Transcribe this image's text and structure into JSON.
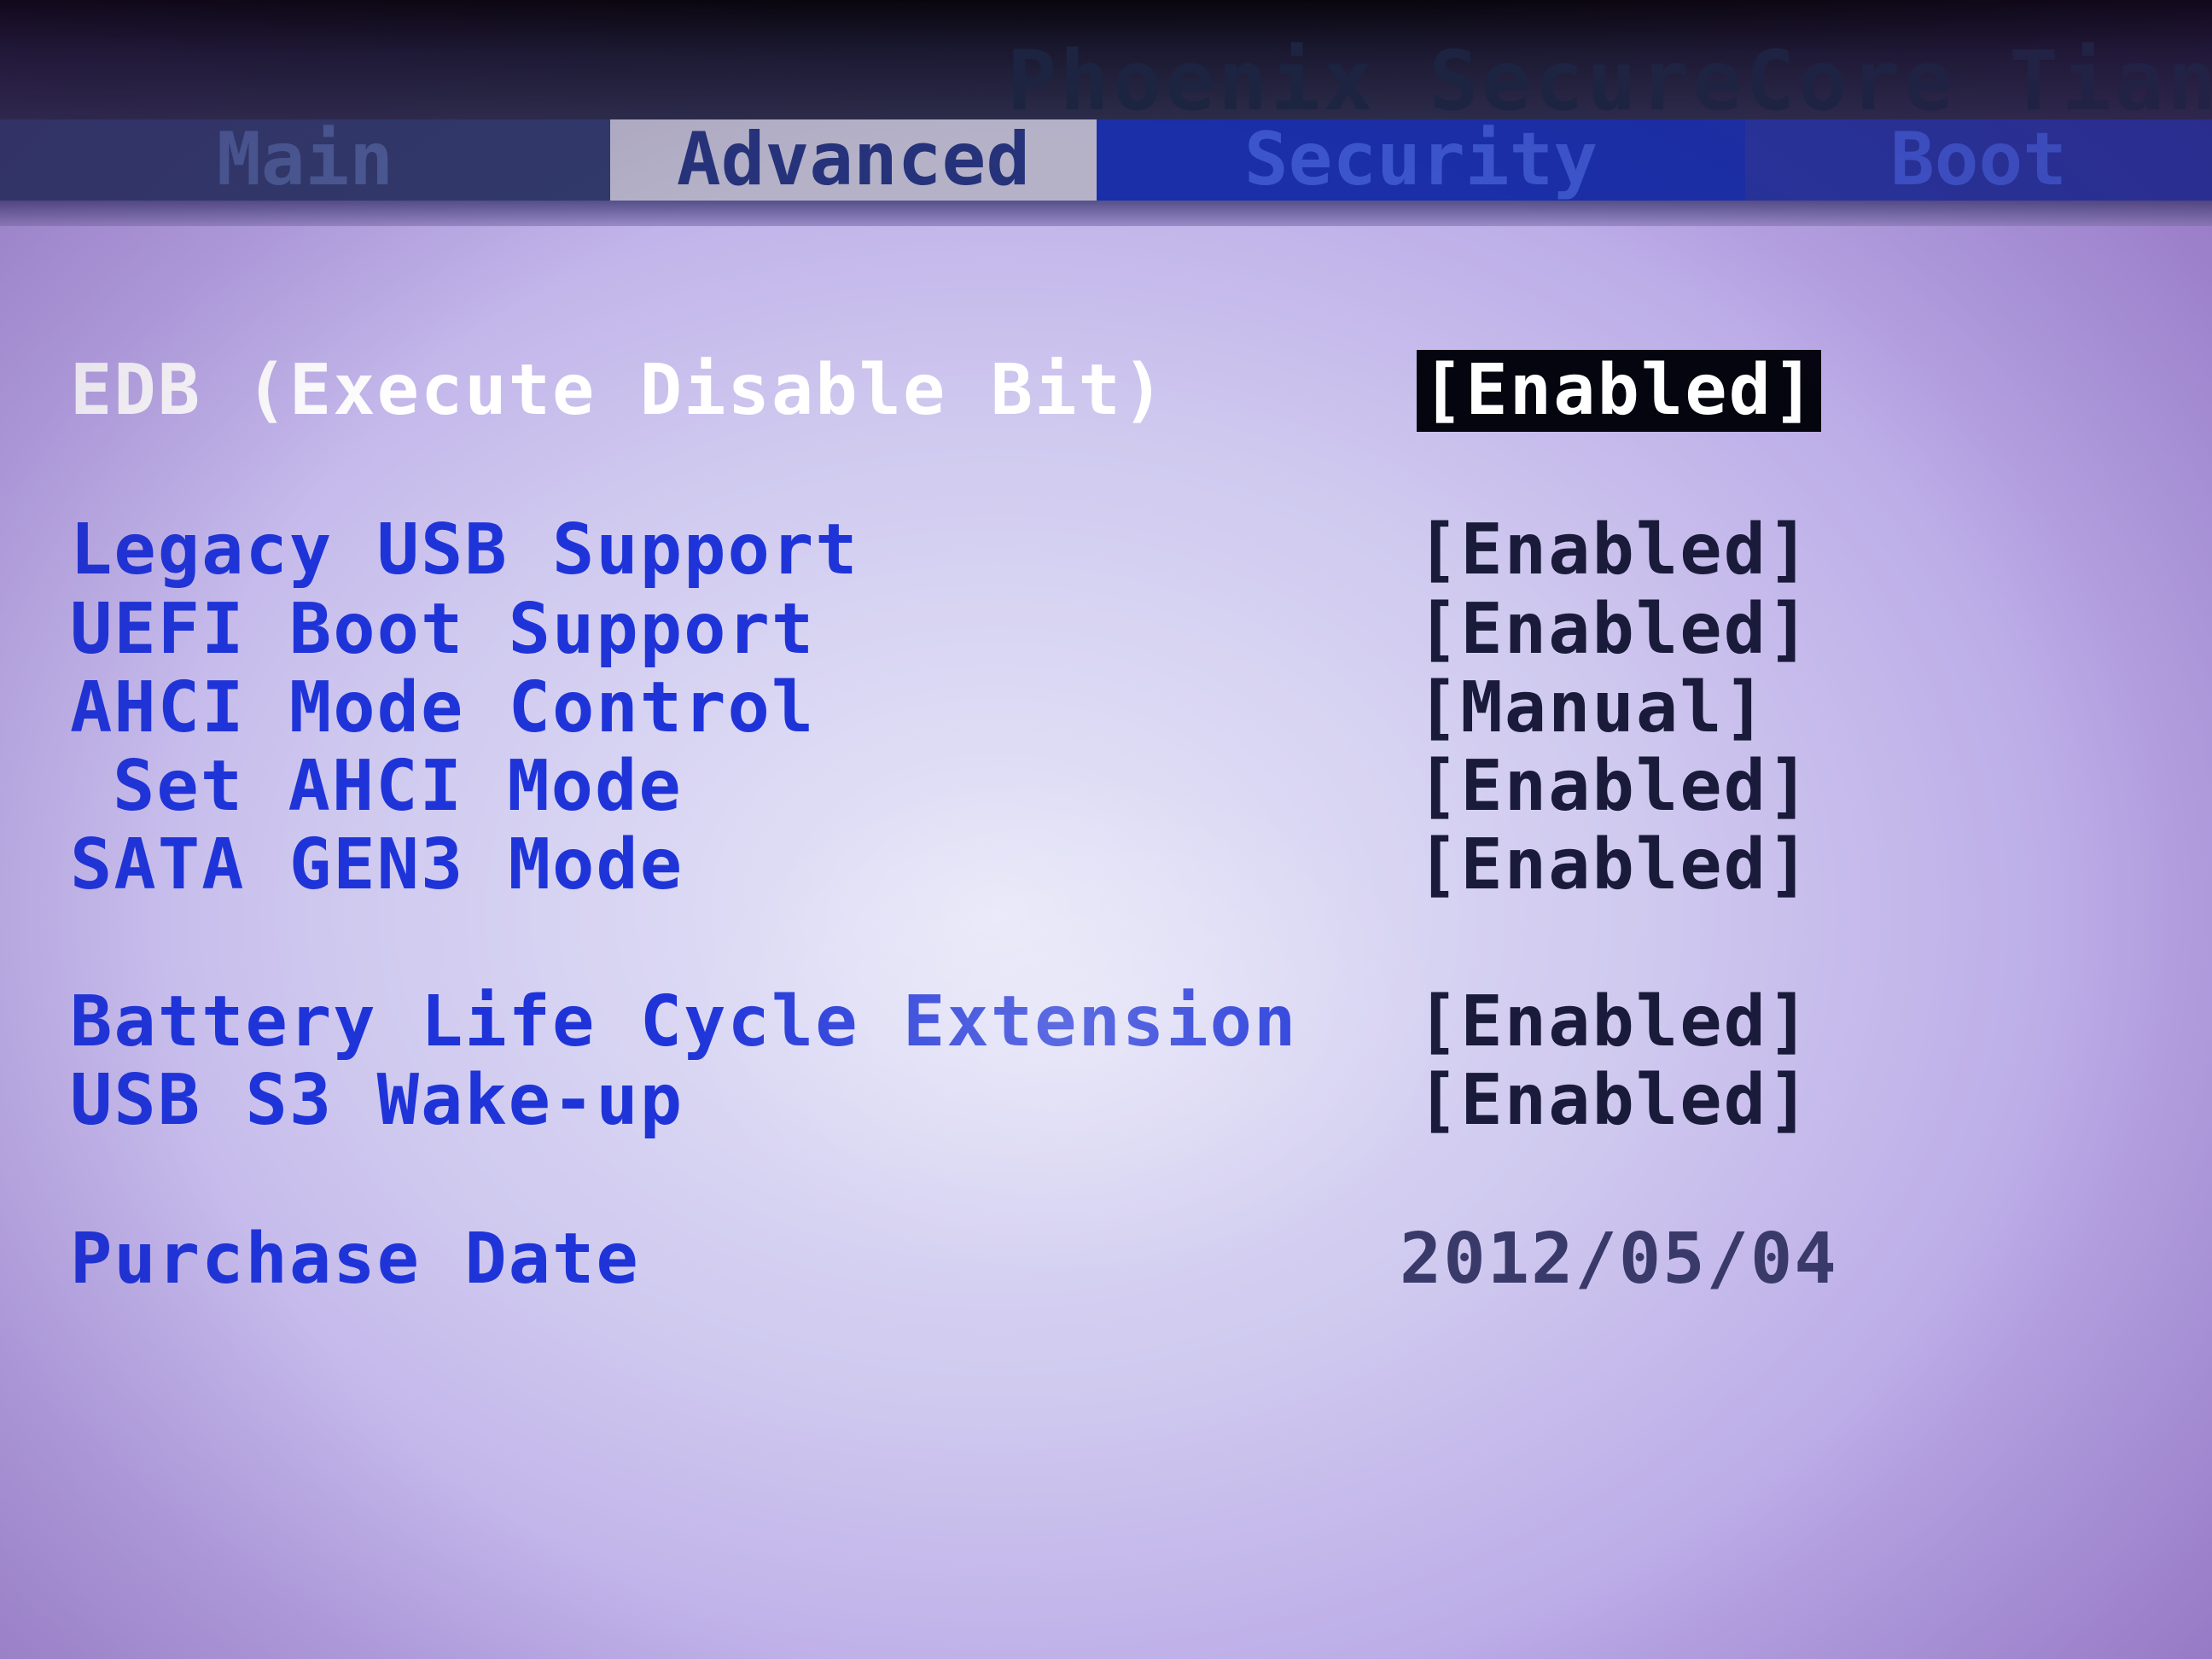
{
  "header": {
    "brand": "Phoenix SecureCore Tiano"
  },
  "tabs": [
    {
      "label": "Main"
    },
    {
      "label": "Advanced"
    },
    {
      "label": "Security"
    },
    {
      "label": "Boot"
    }
  ],
  "active_tab": "Advanced",
  "settings": [
    {
      "label": "EDB (Execute Disable Bit)",
      "value": "[Enabled]",
      "selected": true
    },
    {
      "label": "Legacy USB Support",
      "value": "[Enabled]"
    },
    {
      "label": "UEFI Boot Support",
      "value": "[Enabled]"
    },
    {
      "label": "AHCI Mode Control",
      "value": "[Manual]"
    },
    {
      "label": "Set AHCI Mode",
      "value": "[Enabled]"
    },
    {
      "label": "SATA GEN3 Mode",
      "value": "[Enabled]"
    },
    {
      "label": "Battery Life Cycle Extension",
      "value": "[Enabled]"
    },
    {
      "label": "USB S3 Wake-up",
      "value": "[Enabled]"
    },
    {
      "label": "Purchase Date",
      "value": "2012/05/04"
    }
  ],
  "colors": {
    "label_blue": "#1f34d8",
    "selected_label": "#ffffff",
    "highlight_bg": "#050510",
    "tab_bar": "#27285a"
  }
}
